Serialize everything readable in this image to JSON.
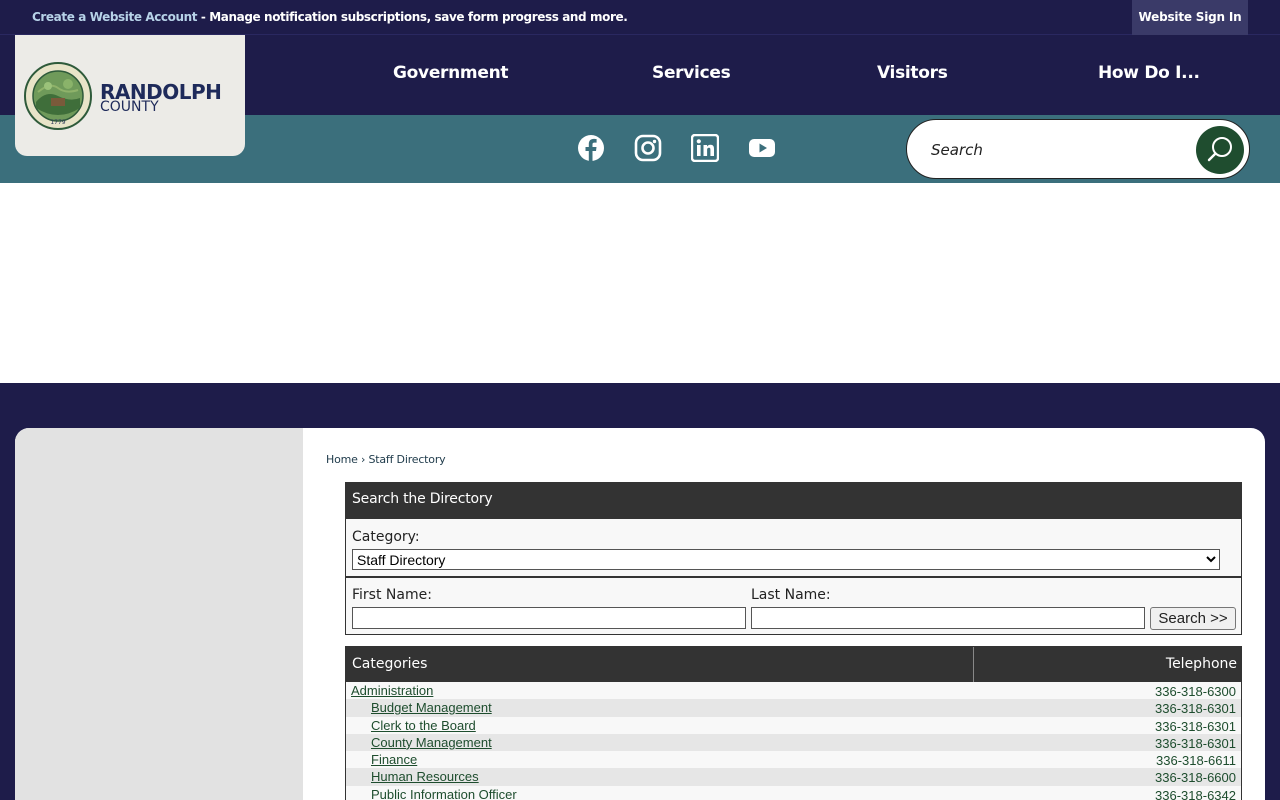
{
  "topbar": {
    "create_account_link": "Create a Website Account",
    "promo_text": " - Manage notification subscriptions, save form progress and more.",
    "signin_label": "Website Sign In"
  },
  "logo": {
    "title": "RANDOLPH",
    "subtitle": "COUNTY",
    "seal_text_top": "RANDOLPH COUNTY, NORTH CAROLINA",
    "seal_year": "1779"
  },
  "nav": {
    "items": [
      "Government",
      "Services",
      "Visitors",
      "How Do I..."
    ]
  },
  "social": {
    "icons": [
      "facebook-icon",
      "instagram-icon",
      "linkedin-icon",
      "youtube-icon"
    ]
  },
  "search": {
    "placeholder": "Search"
  },
  "breadcrumb": {
    "home": "Home",
    "separator": " › ",
    "current": "Staff Directory"
  },
  "directory": {
    "heading": "Search the Directory",
    "category_label": "Category:",
    "category_value": "Staff Directory",
    "first_name_label": "First Name:",
    "last_name_label": "Last Name:",
    "search_button": "Search >>"
  },
  "categories": {
    "header_left": "Categories",
    "header_right": "Telephone",
    "rows": [
      {
        "name": "Administration",
        "phone": "336-318-6300",
        "indent": false
      },
      {
        "name": "Budget Management",
        "phone": "336-318-6301",
        "indent": true
      },
      {
        "name": "Clerk to the Board",
        "phone": "336-318-6301",
        "indent": true
      },
      {
        "name": "County Management",
        "phone": "336-318-6301",
        "indent": true
      },
      {
        "name": "Finance",
        "phone": "336-318-6611",
        "indent": true
      },
      {
        "name": "Human Resources",
        "phone": "336-318-6600",
        "indent": true
      },
      {
        "name": "Public Information Officer",
        "phone": "336-318-6342",
        "indent": true
      }
    ]
  },
  "colors": {
    "navy": "#1e1c4a",
    "teal": "#3b6f7c",
    "green": "#1f4d2f"
  }
}
